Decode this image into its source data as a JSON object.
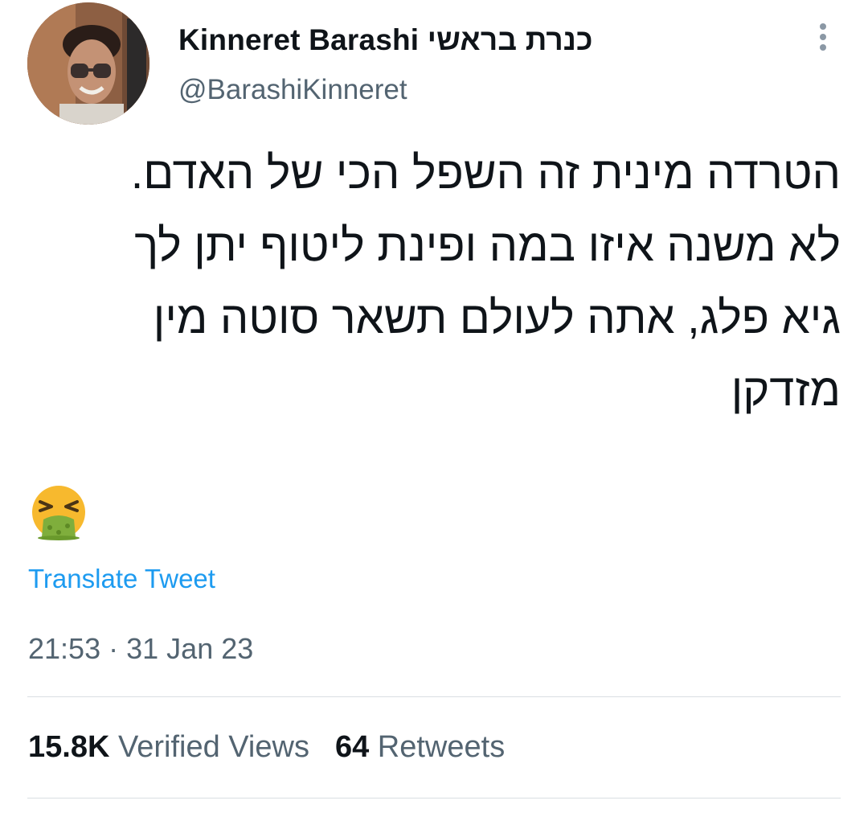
{
  "author": {
    "display_name": "Kinneret Barashi כנרת בראשי",
    "handle": "@BarashiKinneret"
  },
  "tweet": {
    "lines": [
      "הטרדה מינית זה השפל הכי של האדם.",
      "לא משנה איזו במה ופינת ליטוף יתן לך",
      "גיא פלג, אתה לעולם תשאר סוטה מין",
      "מזדקן"
    ],
    "emoji": "nauseated-face-emoji",
    "translate_label": "Translate Tweet",
    "time": "21:53",
    "separator": "·",
    "date": "31 Jan 23"
  },
  "stats": {
    "views_count": "15.8K",
    "views_label": "Verified Views",
    "retweets_count": "64",
    "retweets_label": "Retweets"
  },
  "colors": {
    "link": "#1d9bf0",
    "secondary_text": "#536471",
    "primary_text": "#0f1419",
    "divider": "#d9dee2"
  },
  "icons": {
    "more": "more-vertical-icon"
  }
}
